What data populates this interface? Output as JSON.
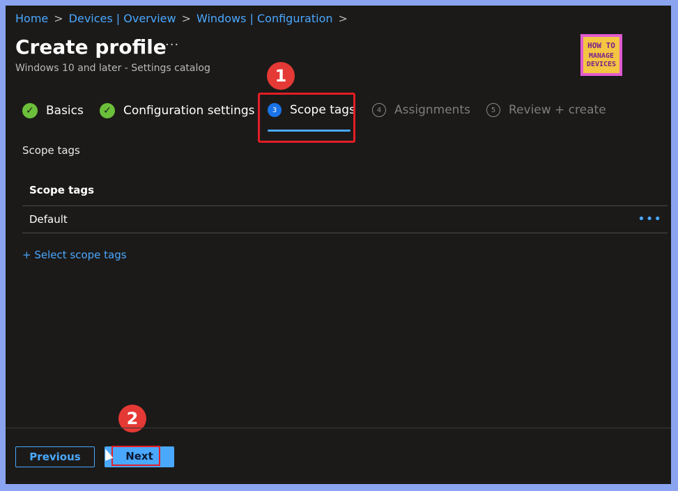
{
  "breadcrumb": {
    "items": [
      "Home",
      "Devices | Overview",
      "Windows | Configuration"
    ],
    "separator": ">"
  },
  "header": {
    "title": "Create profile",
    "more_label": "···",
    "subtitle": "Windows 10 and later - Settings catalog"
  },
  "logo": {
    "line1": "HOW TO",
    "line2": "MANAGE",
    "line3": "DEVICES"
  },
  "annotations": {
    "badge1": "1",
    "badge2": "2"
  },
  "steps": [
    {
      "label": "Basics",
      "state": "done",
      "icon": "check-icon"
    },
    {
      "label": "Configuration settings",
      "state": "done",
      "icon": "check-icon"
    },
    {
      "number": "3",
      "label": "Scope tags",
      "state": "active"
    },
    {
      "number": "4",
      "label": "Assignments",
      "state": "disabled"
    },
    {
      "number": "5",
      "label": "Review + create",
      "state": "disabled"
    }
  ],
  "scope_section": {
    "label": "Scope tags",
    "table_header": "Scope tags",
    "rows": [
      {
        "name": "Default",
        "menu": "•••"
      }
    ],
    "add_link": "+ Select scope tags"
  },
  "footer": {
    "previous_label": "Previous",
    "next_label": "Next"
  },
  "colors": {
    "background": "#1b1a19",
    "accent": "#4aa8ff",
    "success": "#6bbf3a",
    "annotation_red": "#e41e26",
    "frame": "#8aa4f0"
  }
}
